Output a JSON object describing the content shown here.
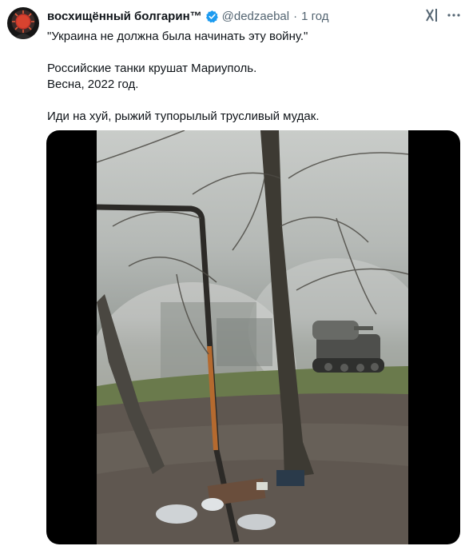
{
  "author": {
    "display_name": "восхищённый болгарин™",
    "handle": "@dedzaebal",
    "separator": "·",
    "time": "1 год",
    "avatar_icon": "red-sun-avatar-icon",
    "verified_color": "#1d9bf0"
  },
  "tweet": {
    "lines": [
      "\"Украина не должна была начинать эту войну.\"",
      "Российские танки крушат Мариуполь.",
      "Весна, 2022 год.",
      "Иди на хуй, рыжий тупорылый трусливый мудак."
    ]
  },
  "actions": {
    "grok_icon": "grok-icon",
    "more_icon": "more-options-icon"
  },
  "media": {
    "type": "video",
    "scene": "tank-in-mariupol-video-frame"
  }
}
